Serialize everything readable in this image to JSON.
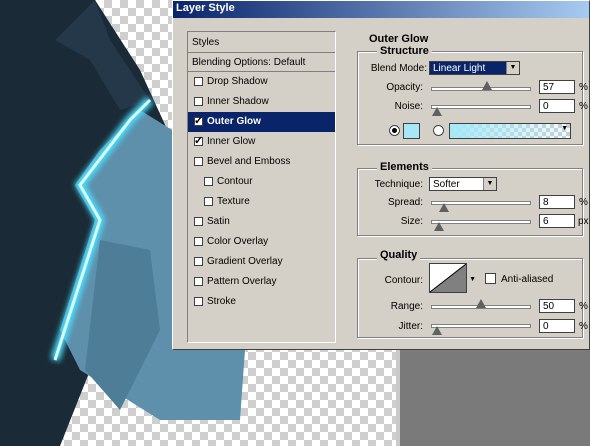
{
  "dialog": {
    "title": "Layer Style"
  },
  "styles": {
    "header": "Styles",
    "blending": "Blending Options: Default",
    "items": [
      {
        "label": "Drop Shadow",
        "checked": false,
        "selected": false,
        "indent": false
      },
      {
        "label": "Inner Shadow",
        "checked": false,
        "selected": false,
        "indent": false
      },
      {
        "label": "Outer Glow",
        "checked": true,
        "selected": true,
        "indent": false
      },
      {
        "label": "Inner Glow",
        "checked": true,
        "selected": false,
        "indent": false
      },
      {
        "label": "Bevel and Emboss",
        "checked": false,
        "selected": false,
        "indent": false
      },
      {
        "label": "Contour",
        "checked": false,
        "selected": false,
        "indent": true
      },
      {
        "label": "Texture",
        "checked": false,
        "selected": false,
        "indent": true
      },
      {
        "label": "Satin",
        "checked": false,
        "selected": false,
        "indent": false
      },
      {
        "label": "Color Overlay",
        "checked": false,
        "selected": false,
        "indent": false
      },
      {
        "label": "Gradient Overlay",
        "checked": false,
        "selected": false,
        "indent": false
      },
      {
        "label": "Pattern Overlay",
        "checked": false,
        "selected": false,
        "indent": false
      },
      {
        "label": "Stroke",
        "checked": false,
        "selected": false,
        "indent": false
      }
    ]
  },
  "outer_glow": {
    "title": "Outer Glow",
    "structure": {
      "title": "Structure",
      "blend_mode_label": "Blend Mode:",
      "blend_mode_value": "Linear Light",
      "opacity_label": "Opacity:",
      "opacity_value": "57",
      "opacity_level": 0.57,
      "noise_label": "Noise:",
      "noise_value": "0",
      "noise_level": 0,
      "percent": "%",
      "glow_color": "#a6e8f8"
    },
    "elements": {
      "title": "Elements",
      "technique_label": "Technique:",
      "technique_value": "Softer",
      "spread_label": "Spread:",
      "spread_value": "8",
      "spread_level": 0.08,
      "size_label": "Size:",
      "size_value": "6",
      "size_level": 0.024,
      "percent": "%",
      "px": "px"
    },
    "quality": {
      "title": "Quality",
      "contour_label": "Contour:",
      "antialias_label": "Anti-aliased",
      "antialias_checked": false,
      "range_label": "Range:",
      "range_value": "50",
      "range_level": 0.5,
      "jitter_label": "Jitter:",
      "jitter_value": "0",
      "jitter_level": 0,
      "percent": "%"
    }
  }
}
